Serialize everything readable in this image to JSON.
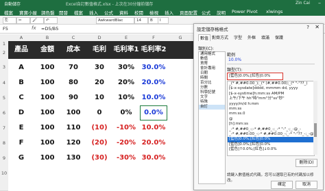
{
  "titlebar": {
    "autosave": "自動儲存",
    "title": "Excel自訂數值格式.xlsx - 上次在30分鐘前儲存",
    "user": "Zin Cai"
  },
  "menu": [
    "檔案",
    "常用",
    "插入",
    "頁面配置",
    "公式",
    "資料",
    "校閱",
    "檢視",
    "開發人員",
    "說明",
    "Power Pivot",
    "xlwings"
  ],
  "menu_visible": [
    "檔案",
    "寶寶小屋",
    "調色盤",
    "開發",
    "檔案",
    "插入",
    "公式",
    "資料",
    "校閱",
    "檢視",
    "插入",
    "頁面配置",
    "公式",
    "說明",
    "Power Pivot",
    "xlwings"
  ],
  "ribbon": {
    "font_name": "AwkwardBlac",
    "font_size": "14"
  },
  "formula_bar": {
    "cell_ref": "F5",
    "fx": "fx",
    "formula": "=D5/B5"
  },
  "columns": [
    "A",
    "B",
    "C",
    "D",
    "E",
    "F",
    "G"
  ],
  "rows": [
    "1",
    "2",
    "3",
    "4",
    "5",
    "6",
    "7",
    "8",
    "9",
    "10"
  ],
  "table": {
    "headers": [
      "產品",
      "金額",
      "成本",
      "毛利",
      "毛利率1",
      "毛利率2"
    ],
    "data": [
      [
        "A",
        "100",
        "70",
        "30",
        "30%",
        "30.0%"
      ],
      [
        "B",
        "100",
        "80",
        "20",
        "20%",
        "20.0%"
      ],
      [
        "C",
        "100",
        "90",
        "10",
        "10%",
        "10.0%"
      ],
      [
        "D",
        "100",
        "100",
        "0",
        "0%",
        "0.0%"
      ],
      [
        "E",
        "100",
        "110",
        "(10)",
        "-10%",
        "10.0%"
      ],
      [
        "F",
        "100",
        "120",
        "(20)",
        "-20%",
        "20.0%"
      ],
      [
        "G",
        "100",
        "130",
        "(30)",
        "-30%",
        "30.0%"
      ]
    ]
  },
  "dialog": {
    "title": "設定儲存格格式",
    "help": "?",
    "close": "✕",
    "tabs": [
      "數值",
      "對齊方式",
      "字型",
      "外框",
      "填滿",
      "保護"
    ],
    "category_label": "類別(C):",
    "categories": [
      "通用格式",
      "數值",
      "貨幣",
      "會計專用",
      "日期",
      "時間",
      "百分比",
      "分數",
      "科學記號",
      "文字",
      "特殊",
      "自訂"
    ],
    "selected_category": "自訂",
    "sample_label": "範例",
    "sample_value": "10.0%",
    "type_label": "類型(T):",
    "type_value": "[藍色]0.0%;[紅色]0.0%",
    "types": [
      "_(* #,##0.00_);_(* (#,##0.00);_(* \"-\"??_)",
      "[$-x-sysdate]dddd, mmmm dd, yyyy",
      "[$-x-systime]h:mm:ss AM/PM",
      "上午/下午 hh\"時\"mm\"分\"ss\"秒\"",
      "yyyy/m/d h:mm",
      "mm:ss",
      "mm:ss.0",
      "@",
      "[h]:mm:ss",
      "_-* #,##0_-;-* #,##0_-;_-* \"-\"_-;_-@_-",
      "_-* #,##0.00_-;-* #,##0.00_-;_-* \"-\"??_-;_-@_-",
      "[藍色]0.0%;[紅色]0.0%",
      "[藍色]0.0%;[紅色]0.0%",
      "[藍色]↑0.0%;[紅色]↓0.0%"
    ],
    "selected_type_index": 11,
    "delete_button": "刪除(D)",
    "hint": "請鍵入數值格式代碼，您可以選取已有的代碼加以修改。",
    "ok_button": "確定",
    "cancel_button": "取消"
  },
  "colors": {
    "header_bg": "#2a2a2a",
    "positive": "#1a3ad8",
    "negative": "#d62020",
    "excel_green": "#1e6e40"
  }
}
